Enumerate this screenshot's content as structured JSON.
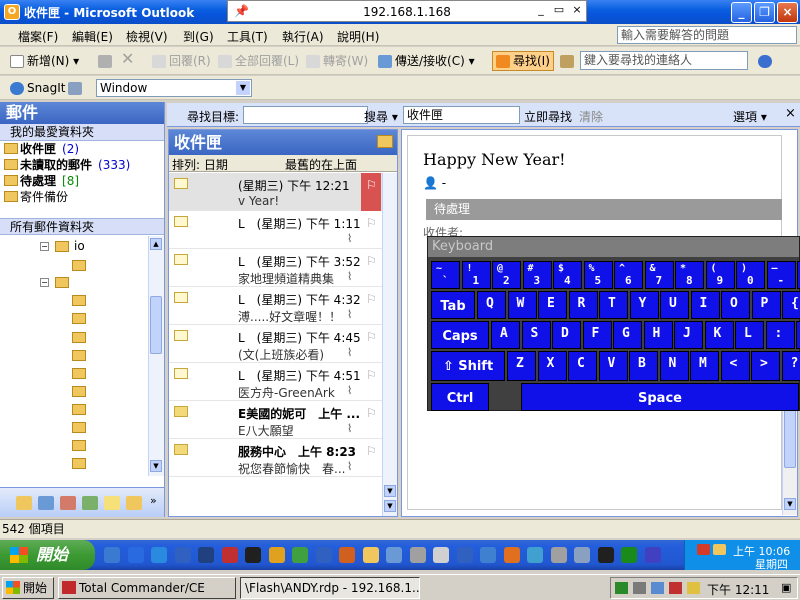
{
  "window": {
    "title": "收件匣 - Microsoft Outlook",
    "remote_host": "192.168.1.168"
  },
  "menu": {
    "items": [
      "檔案(F)",
      "編輯(E)",
      "檢視(V)",
      "到(G)",
      "工具(T)",
      "執行(A)",
      "說明(H)"
    ],
    "help_placeholder": "輸入需要解答的問題"
  },
  "toolbar": {
    "new": "新增(N)",
    "reply": "回覆(R)",
    "reply_all": "全部回覆(L)",
    "forward": "轉寄(W)",
    "send_receive": "傳送/接收(C)",
    "find": "尋找(I)",
    "contact_placeholder": "鍵入要尋找的連絡人",
    "snagit": "SnagIt",
    "window_select": "Window"
  },
  "nav": {
    "header": "郵件",
    "favorites_title": "我的最愛資料夾",
    "favorites": [
      {
        "label": "收件匣",
        "count": "(2)",
        "count_style": "blue",
        "bold": true
      },
      {
        "label": "未讀取的郵件",
        "count": "(333)",
        "count_style": "blue",
        "bold": true
      },
      {
        "label": "待處理",
        "count": "[8]",
        "count_style": "green",
        "bold": true
      },
      {
        "label": "寄件備份",
        "count": "",
        "count_style": "none",
        "bold": false
      }
    ],
    "all_folders_title": "所有郵件資料夾",
    "tree_top_label": "io"
  },
  "findbar": {
    "target_label": "尋找目標:",
    "search_label": "搜尋",
    "search_in": "收件匣",
    "find_now": "立即尋找",
    "clear": "清除",
    "options": "選項"
  },
  "message_list": {
    "title": "收件匣",
    "sort_by": "排列: 日期",
    "sort_order": "最舊的在上面",
    "messages": [
      {
        "line1": "(星期三) 下午 12:21",
        "line2": "v Year!",
        "bold": false,
        "selected": true,
        "attachment": false
      },
      {
        "line1": "L　(星期三) 下午 1:11",
        "line2": "",
        "bold": false,
        "selected": false,
        "attachment": true
      },
      {
        "line1": "L　(星期三) 下午 3:52",
        "line2": "家地理頻道精典集",
        "bold": false,
        "selected": false,
        "attachment": true
      },
      {
        "line1": "L　(星期三) 下午 4:32",
        "line2": "溥.....好文章喔！！",
        "bold": false,
        "selected": false,
        "attachment": true
      },
      {
        "line1": "L　(星期三) 下午 4:45",
        "line2": "(文(上班族必看)",
        "bold": false,
        "selected": false,
        "attachment": true
      },
      {
        "line1": "L　(星期三) 下午 4:51",
        "line2": "医方舟-GreenArk",
        "bold": false,
        "selected": false,
        "attachment": true
      },
      {
        "line1": "E美國的妮可　上午 ...",
        "line2": "E八大願望",
        "bold": true,
        "selected": false,
        "attachment": true
      },
      {
        "line1": "服務中心　上午 8:23",
        "line2": "祝您春節愉快　春...",
        "bold": true,
        "selected": false,
        "attachment": true
      }
    ]
  },
  "reading_pane": {
    "subject": "Happy New Year!",
    "sender": "-",
    "category": "待處理",
    "recipient_label": "收件者:"
  },
  "keyboard": {
    "title": "Keyboard",
    "row1": [
      [
        "~",
        "`"
      ],
      [
        "!",
        "1"
      ],
      [
        "@",
        "2"
      ],
      [
        "#",
        "3"
      ],
      [
        "$",
        "4"
      ],
      [
        "%",
        "5"
      ],
      [
        "^",
        "6"
      ],
      [
        "&",
        "7"
      ],
      [
        "*",
        "8"
      ],
      [
        "(",
        "9"
      ],
      [
        ")",
        "0"
      ],
      [
        "—",
        "-"
      ],
      [
        "+",
        "="
      ]
    ],
    "row2_label": "Tab",
    "row2": [
      "Q",
      "W",
      "E",
      "R",
      "T",
      "Y",
      "U",
      "I",
      "O",
      "P",
      "{"
    ],
    "row3_label": "Caps",
    "row3": [
      "A",
      "S",
      "D",
      "F",
      "G",
      "H",
      "J",
      "K",
      "L",
      ":",
      "\""
    ],
    "row4_label": "⇧ Shift",
    "row4": [
      "Z",
      "X",
      "C",
      "V",
      "B",
      "N",
      "M",
      "<",
      ">",
      "?"
    ],
    "ctrl": "Ctrl",
    "space": "Space"
  },
  "statusbar": {
    "items": "542 個項目"
  },
  "taskbar": {
    "start": "開始",
    "time": "上午 10:06",
    "day": "星期四"
  },
  "ce_taskbar": {
    "start": "開始",
    "total_commander": "Total Commander/CE",
    "rdp": "\\Flash\\ANDY.rdp - 192.168.1....",
    "time": "下午 12:11"
  },
  "colors": {
    "title_blue": "#0a5fe0",
    "keyboard_key": "#1010e8",
    "category_gray": "#9a9a9a",
    "flag_red": "#d95252",
    "start_green": "#3c9a33"
  }
}
